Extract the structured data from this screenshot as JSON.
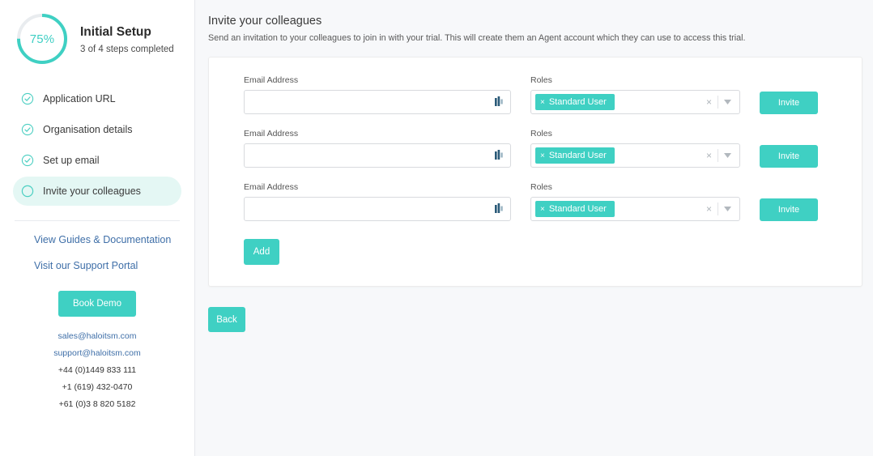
{
  "sidebar": {
    "progress": {
      "percent_label": "75%",
      "percent_value": 75,
      "title": "Initial Setup",
      "subtitle": "3 of 4 steps completed"
    },
    "steps": [
      {
        "label": "Application URL",
        "state": "completed",
        "icon": "check-circle-icon"
      },
      {
        "label": "Organisation details",
        "state": "completed",
        "icon": "check-circle-icon"
      },
      {
        "label": "Set up email",
        "state": "completed",
        "icon": "check-circle-icon"
      },
      {
        "label": "Invite your colleagues",
        "state": "active",
        "icon": "circle-icon"
      }
    ],
    "links": [
      {
        "label": "View Guides & Documentation"
      },
      {
        "label": "Visit our Support Portal"
      }
    ],
    "demo_button": "Book Demo",
    "contacts": [
      {
        "value": "sales@haloitsm.com",
        "type": "email"
      },
      {
        "value": "support@haloitsm.com",
        "type": "email"
      },
      {
        "value": "+44 (0)1449 833 111",
        "type": "phone"
      },
      {
        "value": "+1 (619) 432-0470",
        "type": "phone"
      },
      {
        "value": "+61 (0)3 8 820 5182",
        "type": "phone"
      }
    ]
  },
  "main": {
    "title": "Invite your colleagues",
    "subtitle": "Send an invitation to your colleagues to join in with your trial. This will create them an Agent account which they can use to access this trial.",
    "email_label": "Email Address",
    "roles_label": "Roles",
    "email_placeholder": "",
    "rows": [
      {
        "email_value": "",
        "role_chip": "Standard User",
        "invite_label": "Invite"
      },
      {
        "email_value": "",
        "role_chip": "Standard User",
        "invite_label": "Invite"
      },
      {
        "email_value": "",
        "role_chip": "Standard User",
        "invite_label": "Invite"
      }
    ],
    "add_label": "Add",
    "back_label": "Back",
    "chip_remove_glyph": "×",
    "clear_glyph": "×"
  },
  "colors": {
    "accent": "#3fd0c3",
    "accent_soft": "#e4f7f4",
    "link": "#3f6fa8",
    "page_bg": "#f7f8fa",
    "autofill_icon": "#2a5a78"
  }
}
